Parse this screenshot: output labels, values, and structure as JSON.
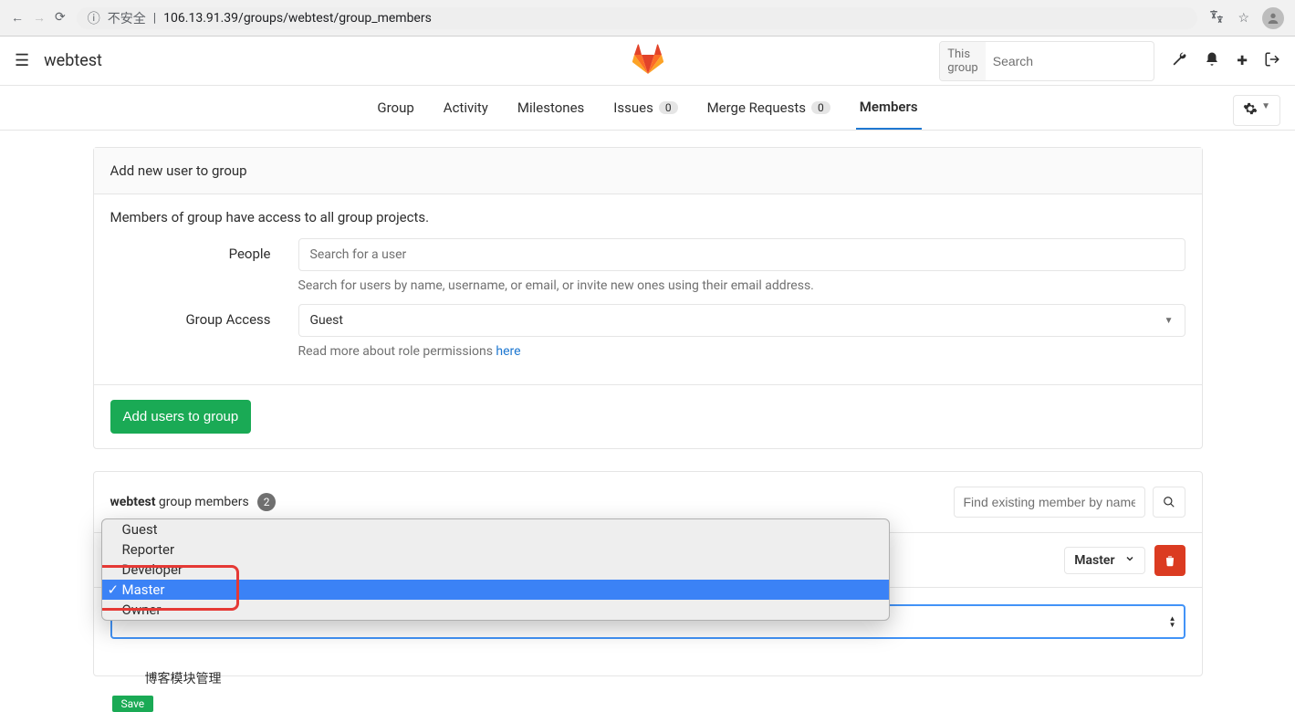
{
  "browser": {
    "insecure_label": "不安全",
    "url": "106.13.91.39/groups/webtest/group_members"
  },
  "header": {
    "brand": "webtest",
    "search_scope": "This group",
    "search_placeholder": "Search"
  },
  "tabs": {
    "group": "Group",
    "activity": "Activity",
    "milestones": "Milestones",
    "issues": "Issues",
    "issues_count": "0",
    "merge_requests": "Merge Requests",
    "mr_count": "0",
    "members": "Members"
  },
  "panel": {
    "title": "Add new user to group",
    "description": "Members of group have access to all group projects.",
    "people_label": "People",
    "people_placeholder": "Search for a user",
    "people_help": "Search for users by name, username, or email, or invite new ones using their email address.",
    "access_label": "Group Access",
    "access_value": "Guest",
    "access_help_prefix": "Read more about role permissions ",
    "access_help_link": "here",
    "submit": "Add users to group"
  },
  "members": {
    "group_name": "webtest",
    "label_suffix": " group members",
    "count": "2",
    "find_placeholder": "Find existing member by name",
    "row_role": "Master",
    "options": {
      "guest": "Guest",
      "reporter": "Reporter",
      "developer": "Developer",
      "master": "Master",
      "owner": "Owner"
    },
    "save": "Save",
    "bottom_text": "博客模块管理"
  }
}
